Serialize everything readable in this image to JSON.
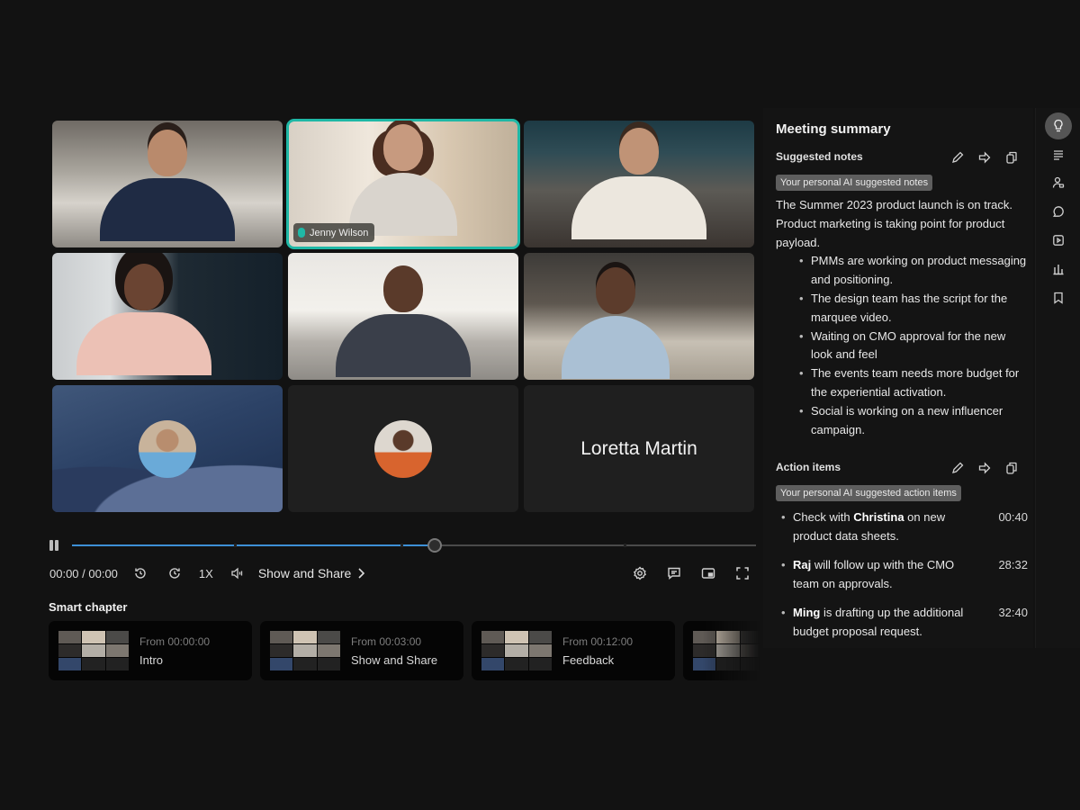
{
  "video_grid": {
    "tiles": [
      {
        "type": "video",
        "name": ""
      },
      {
        "type": "video",
        "name": "Jenny Wilson",
        "active": true
      },
      {
        "type": "video",
        "name": ""
      },
      {
        "type": "video",
        "name": ""
      },
      {
        "type": "video",
        "name": ""
      },
      {
        "type": "video",
        "name": ""
      },
      {
        "type": "avatar",
        "name": ""
      },
      {
        "type": "avatar",
        "name": ""
      },
      {
        "type": "name-only",
        "name": "Loretta Martin"
      }
    ],
    "active_color": "#1fb8a6"
  },
  "playback": {
    "state": "playing",
    "progress": 0.53,
    "segment_markers": [
      0.237,
      0.48,
      0.806
    ],
    "time": "00:00 / 00:00",
    "speed": "1X",
    "current_chapter": "Show and Share",
    "accent_color": "#3d8fd6",
    "left_icons": [
      "rewind-icon",
      "forward-icon",
      "volume-icon"
    ],
    "right_icons": [
      "settings-icon",
      "captions-icon",
      "pip-icon",
      "fullscreen-icon"
    ]
  },
  "smart_chapter": {
    "title": "Smart chapter",
    "chapters": [
      {
        "from": "From 00:00:00",
        "name": "Intro"
      },
      {
        "from": "From 00:03:00",
        "name": "Show and Share"
      },
      {
        "from": "From 00:12:00",
        "name": "Feedback"
      },
      {
        "from": "",
        "name": ""
      }
    ]
  },
  "summary": {
    "title": "Meeting summary",
    "suggested_notes": {
      "heading": "Suggested notes",
      "badge": "Your personal AI suggested notes",
      "intro": "The Summer 2023 product launch is on track. Product marketing is taking point for product payload.",
      "bullets": [
        "PMMs are working on product messaging and positioning.",
        "The design team has the script for the marquee video.",
        "Waiting on CMO approval for the new look and feel",
        "The events team needs more budget for the experiential activation.",
        "Social is working on a new influencer campaign."
      ]
    },
    "action_items": {
      "heading": "Action items",
      "badge": "Your personal AI suggested action items",
      "items": [
        {
          "pre": "Check with ",
          "bold": "Christina",
          "post": " on new product data sheets.",
          "time": "00:40"
        },
        {
          "pre": "",
          "bold": "Raj",
          "post": " will follow up with the CMO team on approvals.",
          "time": "28:32"
        },
        {
          "pre": "",
          "bold": "Ming",
          "post": " is drafting up the additional budget proposal request.",
          "time": "32:40"
        }
      ]
    },
    "tool_icons": [
      "edit-icon",
      "share-icon",
      "copy-icon"
    ]
  },
  "side_rail": {
    "items": [
      {
        "icon": "lightbulb-icon",
        "active": true
      },
      {
        "icon": "transcript-icon",
        "active": false
      },
      {
        "icon": "participants-icon",
        "active": false
      },
      {
        "icon": "chat-icon",
        "active": false
      },
      {
        "icon": "highlights-icon",
        "active": false
      },
      {
        "icon": "analytics-icon",
        "active": false
      },
      {
        "icon": "bookmark-icon",
        "active": false
      }
    ]
  }
}
